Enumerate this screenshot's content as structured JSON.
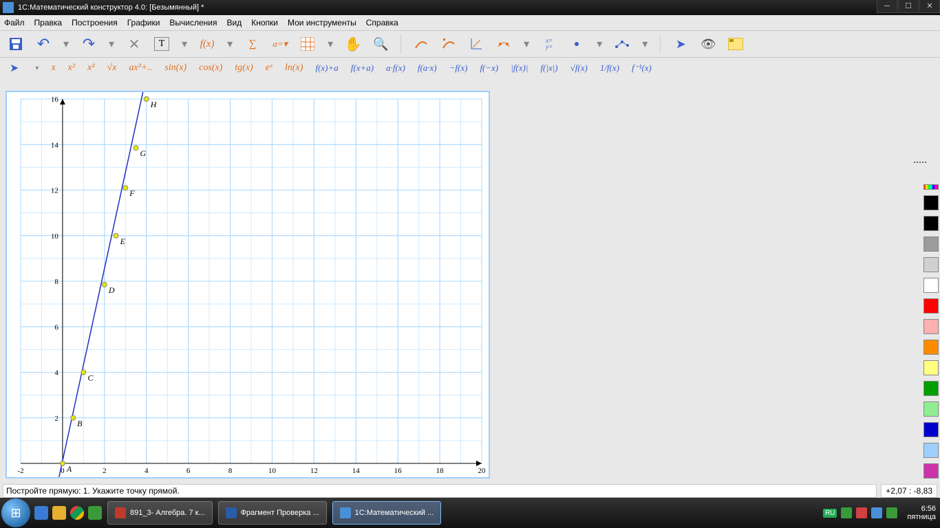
{
  "window": {
    "title": "1С:Математический конструктор 4.0: [Безымянный] *"
  },
  "menu": {
    "items": [
      "Файл",
      "Правка",
      "Построения",
      "Графики",
      "Вычисления",
      "Вид",
      "Кнопки",
      "Мои инструменты",
      "Справка"
    ]
  },
  "toolbar1_labels": {
    "fx": "f(x)",
    "sigma": "∑",
    "assign": "a=▾",
    "xy": "x=\ny="
  },
  "toolbar2": {
    "orange": [
      "x",
      "x²",
      "x³",
      "√x",
      "ax³+..",
      "sin(x)",
      "cos(x)",
      "tg(x)",
      "eˣ",
      "ln(x)"
    ],
    "blue": [
      "f(x)+a",
      "f(x+a)",
      "a·f(x)",
      "f(a·x)",
      "−f(x)",
      "f(−x)",
      "|f(x)|",
      "f(|x|)",
      "√f(x)",
      "1/f(x)",
      "f⁻¹(x)"
    ]
  },
  "status": {
    "hint": "Постройте прямую: 1. Укажите точку прямой.",
    "coord": "+2,07 : -8,83"
  },
  "palette_colors": [
    "#000000",
    "#000000",
    "#9b9b9b",
    "#d0d0d0",
    "#ffffff",
    "#ff0000",
    "#ffb0b0",
    "#ff8c00",
    "#ffff80",
    "#009f00",
    "#90ee90",
    "#0000cd",
    "#9fcfff",
    "#cc33aa"
  ],
  "taskbar": {
    "apps": [
      {
        "label": "891_3- Алгебра. 7 к...",
        "color": "#c0392b"
      },
      {
        "label": "Фрагмент Проверка ...",
        "color": "#2a5ca8"
      },
      {
        "label": "1С:Математический ...",
        "color": "#4a90d9",
        "active": true
      }
    ],
    "lang": "RU",
    "time": "6:56",
    "day": "пятница"
  },
  "chart_data": {
    "type": "line",
    "title": "",
    "xlabel": "",
    "ylabel": "",
    "xlim": [
      -2,
      20
    ],
    "ylim": [
      0,
      16
    ],
    "x_ticks": [
      -2,
      0,
      2,
      4,
      6,
      8,
      10,
      12,
      14,
      16,
      18,
      20
    ],
    "y_ticks": [
      0,
      2,
      4,
      6,
      8,
      10,
      12,
      14,
      16
    ],
    "grid": true,
    "series": [
      {
        "name": "line",
        "x": [
          -0.5,
          4
        ],
        "y": [
          -2,
          17
        ],
        "color": "#2030c0"
      }
    ],
    "points": [
      {
        "name": "A",
        "x": 0,
        "y": 0
      },
      {
        "name": "B",
        "x": 0.5,
        "y": 2
      },
      {
        "name": "C",
        "x": 1,
        "y": 4
      },
      {
        "name": "D",
        "x": 2,
        "y": 7.85
      },
      {
        "name": "E",
        "x": 2.55,
        "y": 10
      },
      {
        "name": "F",
        "x": 3,
        "y": 12.1
      },
      {
        "name": "G",
        "x": 3.5,
        "y": 13.85
      },
      {
        "name": "H",
        "x": 4,
        "y": 16
      }
    ]
  }
}
